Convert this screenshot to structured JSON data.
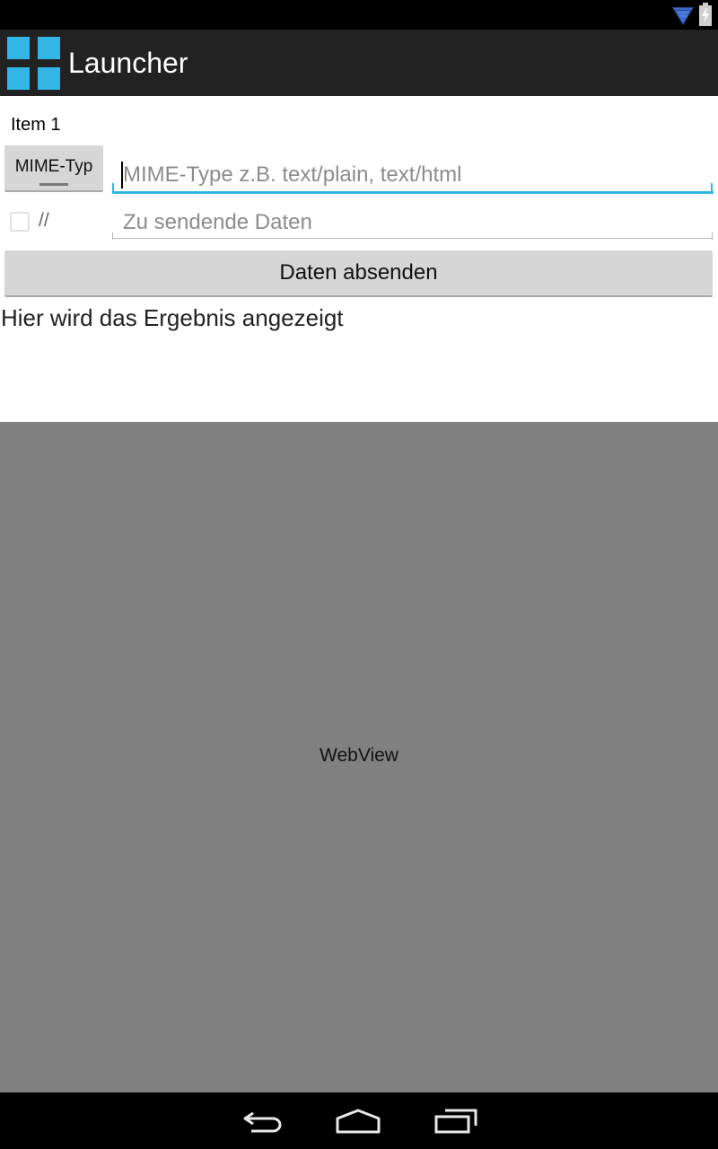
{
  "statusbar": {
    "icons": [
      "wifi-icon",
      "battery-icon"
    ]
  },
  "actionbar": {
    "title": "Launcher",
    "icon": "app-grid-icon",
    "accent_color": "#33b5e5"
  },
  "form": {
    "item_label": "Item 1",
    "spinner_label": "MIME-Typ",
    "mime_input": {
      "value": "",
      "placeholder": "MIME-Type z.B. text/plain, text/html"
    },
    "checkbox_checked": false,
    "comment_label": "//",
    "data_input": {
      "value": "",
      "placeholder": "Zu sendende Daten"
    },
    "send_button": "Daten absenden",
    "result_text": "Hier wird das Ergebnis angezeigt"
  },
  "webview": {
    "label": "WebView",
    "background": "#808080"
  },
  "navbar": {
    "buttons": [
      "back-icon",
      "home-icon",
      "recents-icon"
    ]
  }
}
